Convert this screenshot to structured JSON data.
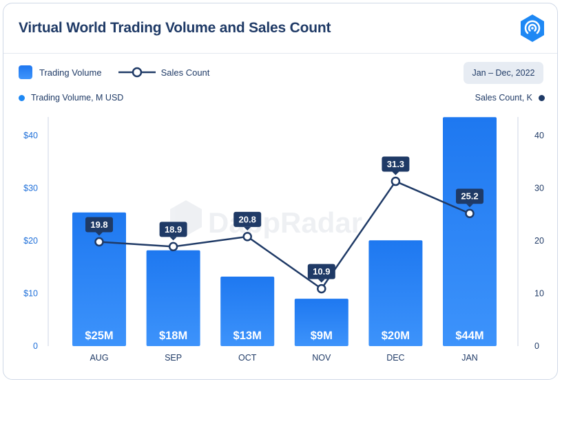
{
  "header": {
    "title": "Virtual World Trading Volume and Sales Count",
    "logo_icon": "dappradar-logo-icon"
  },
  "legend": {
    "bar_label": "Trading Volume",
    "line_label": "Sales Count"
  },
  "date_range": "Jan – Dec, 2022",
  "axes": {
    "left_title": "Trading Volume, M USD",
    "right_title": "Sales Count, K"
  },
  "watermark": "DappRadar",
  "colors": {
    "bar_top": "#1e78f0",
    "bar_bottom": "#3d93fb",
    "line": "#1f3a66",
    "left_axis_text": "#1e6fd9",
    "text": "#1f3a66"
  },
  "chart_data": {
    "type": "bar",
    "categories": [
      "AUG",
      "SEP",
      "OCT",
      "NOV",
      "DEC",
      "JAN"
    ],
    "series": [
      {
        "name": "Trading Volume",
        "type": "bar",
        "axis": "left",
        "values": [
          25.4,
          18.2,
          13.2,
          9.0,
          20.1,
          43.5
        ],
        "labels": [
          "$25M",
          "$18M",
          "$13M",
          "$9M",
          "$20M",
          "$44M"
        ]
      },
      {
        "name": "Sales Count",
        "type": "line",
        "axis": "right",
        "values": [
          19.8,
          18.9,
          20.8,
          10.9,
          31.3,
          25.2
        ],
        "labels": [
          "19.8",
          "18.9",
          "20.8",
          "10.9",
          "31.3",
          "25.2"
        ]
      }
    ],
    "left_axis": {
      "ylim": [
        0,
        40
      ],
      "ticks": [
        "0",
        "$10",
        "$20",
        "$30",
        "$40"
      ]
    },
    "right_axis": {
      "ylim": [
        0,
        40
      ],
      "ticks": [
        "0",
        "10",
        "20",
        "30",
        "40"
      ]
    },
    "grid": false,
    "legend_position": "top-left"
  }
}
